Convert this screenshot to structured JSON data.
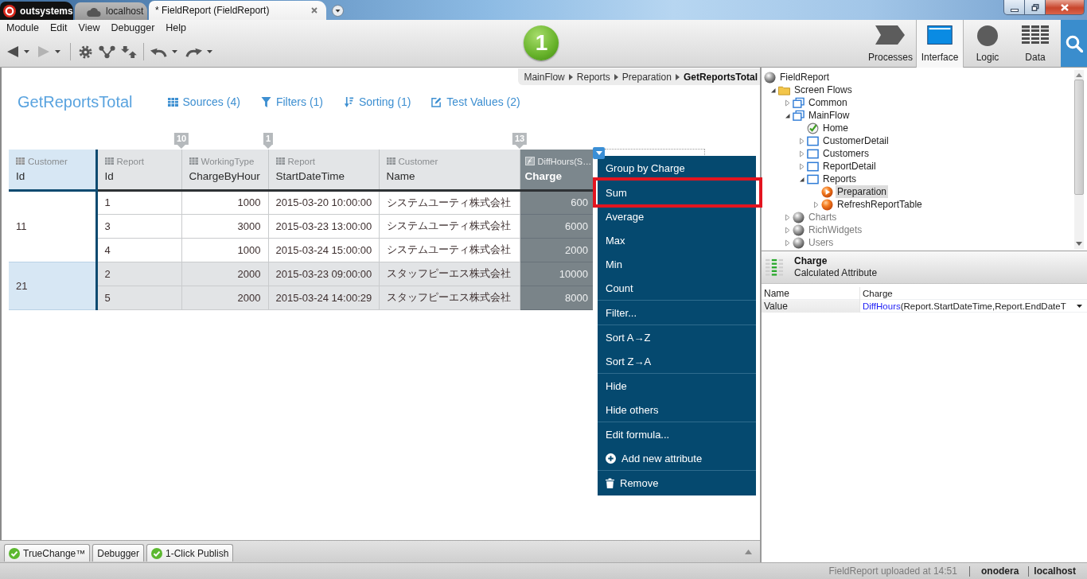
{
  "title_bar": {
    "tabs": [
      {
        "label": "outsystems",
        "kind": "logo",
        "selected": false
      },
      {
        "label": "localhost",
        "kind": "server",
        "selected": false
      },
      {
        "label": "* FieldReport (FieldReport)",
        "kind": "module",
        "selected": true
      }
    ]
  },
  "menu_bar": [
    "Module",
    "Edit",
    "View",
    "Debugger",
    "Help"
  ],
  "toolbar": {
    "back_disabled": false,
    "forward_disabled": true
  },
  "publish_button": "1",
  "mode_tabs": [
    {
      "label": "Processes",
      "kind": "processes",
      "selected": false
    },
    {
      "label": "Interface",
      "kind": "interface",
      "selected": true
    },
    {
      "label": "Logic",
      "kind": "logic",
      "selected": false
    },
    {
      "label": "Data",
      "kind": "data",
      "selected": false
    }
  ],
  "breadcrumb": [
    {
      "label": "MainFlow",
      "current": false
    },
    {
      "label": "Reports",
      "current": false
    },
    {
      "label": "Preparation",
      "current": false
    },
    {
      "label": "GetReportsTotal",
      "current": true
    }
  ],
  "aggregate": {
    "title": "GetReportsTotal",
    "links": [
      {
        "label": "Sources (4)",
        "kind": "sources"
      },
      {
        "label": "Filters (1)",
        "kind": "filters"
      },
      {
        "label": "Sorting (1)",
        "kind": "sorting"
      },
      {
        "label": "Test Values (2)",
        "kind": "test_values"
      }
    ]
  },
  "table": {
    "columns": [
      {
        "entity": "Customer",
        "name": "Id",
        "kind": "group",
        "menu_open": false
      },
      {
        "entity": "Report",
        "name": "Id",
        "kind": "identifier",
        "menu_open": false
      },
      {
        "entity": "WorkingType",
        "name": "ChargeByHour",
        "kind": "integer",
        "marker": "10",
        "menu_open": false
      },
      {
        "entity": "Report",
        "name": "StartDateTime",
        "kind": "datetime",
        "marker": "1",
        "menu_open": false
      },
      {
        "entity": "Customer",
        "name": "Name",
        "kind": "text",
        "menu_open": false
      },
      {
        "entity": "DiffHours(S…",
        "name": "Charge",
        "kind": "calculated",
        "marker": "13",
        "menu_open": true
      }
    ],
    "groups": [
      {
        "value": "11",
        "rows": [
          [
            "1",
            "1000",
            "2015-03-20 10:00:00",
            "システムユーティ株式会社",
            "600"
          ],
          [
            "3",
            "3000",
            "2015-03-23 13:00:00",
            "システムユーティ株式会社",
            "6000"
          ],
          [
            "4",
            "1000",
            "2015-03-24 15:00:00",
            "システムユーティ株式会社",
            "2000"
          ]
        ]
      },
      {
        "value": "21",
        "rows": [
          [
            "2",
            "2000",
            "2015-03-23 09:00:00",
            "スタッフピーエス株式会社",
            "10000"
          ],
          [
            "5",
            "2000",
            "2015-03-24 14:00:29",
            "スタッフピーエス株式会社",
            "8000"
          ]
        ]
      }
    ]
  },
  "context_menu": {
    "groups": [
      [
        {
          "label": "Group by Charge",
          "kind": "plain",
          "highlighted": false
        }
      ],
      [
        {
          "label": "Sum",
          "kind": "plain",
          "highlighted": true
        },
        {
          "label": "Average",
          "kind": "plain",
          "highlighted": false
        },
        {
          "label": "Max",
          "kind": "plain",
          "highlighted": false
        },
        {
          "label": "Min",
          "kind": "plain",
          "highlighted": false
        },
        {
          "label": "Count",
          "kind": "plain",
          "highlighted": false
        }
      ],
      [
        {
          "label": "Filter...",
          "kind": "plain",
          "highlighted": false
        }
      ],
      [
        {
          "label": "Sort A→Z",
          "kind": "plain",
          "highlighted": false
        },
        {
          "label": "Sort Z→A",
          "kind": "plain",
          "highlighted": false
        }
      ],
      [
        {
          "label": "Hide",
          "kind": "plain",
          "highlighted": false
        },
        {
          "label": "Hide others",
          "kind": "plain",
          "highlighted": false
        }
      ],
      [
        {
          "label": "Edit formula...",
          "kind": "plain",
          "highlighted": false
        },
        {
          "label": "Add new attribute",
          "kind": "add",
          "highlighted": false
        }
      ],
      [
        {
          "label": "Remove",
          "kind": "remove",
          "highlighted": false
        }
      ]
    ]
  },
  "tree": [
    {
      "label": "FieldReport",
      "kind": "module",
      "selected": false,
      "dimmed": false,
      "children": [
        {
          "label": "Screen Flows",
          "kind": "folder",
          "expanded": true,
          "selected": false,
          "dimmed": false,
          "children": [
            {
              "label": "Common",
              "kind": "flow",
              "expanded": false,
              "selected": false,
              "dimmed": false
            },
            {
              "label": "MainFlow",
              "kind": "flow",
              "expanded": true,
              "selected": false,
              "dimmed": false,
              "children": [
                {
                  "label": "Home",
                  "kind": "home_screen",
                  "selected": false,
                  "dimmed": false
                },
                {
                  "label": "CustomerDetail",
                  "kind": "screen",
                  "expanded": false,
                  "selected": false,
                  "dimmed": false
                },
                {
                  "label": "Customers",
                  "kind": "screen",
                  "expanded": false,
                  "selected": false,
                  "dimmed": false
                },
                {
                  "label": "ReportDetail",
                  "kind": "screen",
                  "expanded": false,
                  "selected": false,
                  "dimmed": false
                },
                {
                  "label": "Reports",
                  "kind": "screen",
                  "expanded": true,
                  "selected": false,
                  "dimmed": false,
                  "children": [
                    {
                      "label": "Preparation",
                      "kind": "preparation",
                      "selected": true,
                      "dimmed": false
                    },
                    {
                      "label": "RefreshReportTable",
                      "kind": "action",
                      "expanded": false,
                      "selected": false,
                      "dimmed": false
                    }
                  ]
                }
              ]
            },
            {
              "label": "Charts",
              "kind": "reference",
              "expanded": false,
              "selected": false,
              "dimmed": true
            },
            {
              "label": "RichWidgets",
              "kind": "reference",
              "expanded": false,
              "selected": false,
              "dimmed": true
            },
            {
              "label": "Users",
              "kind": "reference",
              "expanded": false,
              "selected": false,
              "dimmed": true
            }
          ]
        }
      ]
    }
  ],
  "properties": {
    "title": "Charge",
    "subtitle": "Calculated Attribute",
    "rows": [
      {
        "name": "Name",
        "value": [
          {
            "text": "Charge",
            "kind": "plain"
          }
        ],
        "dropdown": false
      },
      {
        "name": "Value",
        "value": [
          {
            "text": "DiffHours",
            "kind": "function"
          },
          {
            "text": "(Report.StartDateTime,Report.EndDateT",
            "kind": "plain"
          }
        ],
        "dropdown": true
      }
    ]
  },
  "panel_tabs": [
    {
      "label": "TrueChange™",
      "ok": true
    },
    {
      "label": "Debugger",
      "ok": false
    },
    {
      "label": "1-Click Publish",
      "ok": true
    }
  ],
  "status_bar": {
    "message": "FieldReport uploaded at 14:51",
    "user": "onodera",
    "server": "localhost"
  }
}
